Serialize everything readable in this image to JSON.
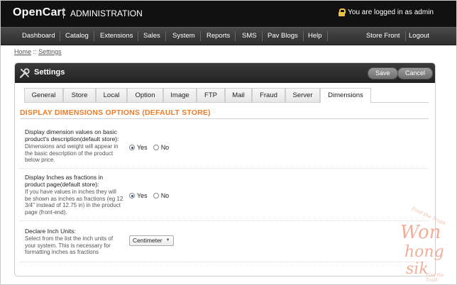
{
  "header": {
    "logo": "OpenCart",
    "title": "ADMINISTRATION",
    "login_status": "You are logged in as admin"
  },
  "nav": {
    "items": [
      "Dashboard",
      "Catalog",
      "Extensions",
      "Sales",
      "System",
      "Reports",
      "SMS",
      "Pav Blogs",
      "Help"
    ],
    "right": [
      "Store Front",
      "Logout"
    ]
  },
  "breadcrumb": {
    "home": "Home",
    "separator": "::",
    "current": "Settings"
  },
  "panel": {
    "title": "Settings",
    "save_label": "Save",
    "cancel_label": "Cancel"
  },
  "tabs": [
    "General",
    "Store",
    "Local",
    "Option",
    "Image",
    "FTP",
    "Mail",
    "Fraud",
    "Server",
    "Dimensions"
  ],
  "active_tab": "Dimensions",
  "section_title": "DISPLAY DIMENSIONS OPTIONS (DEFAULT STORE)",
  "rows": [
    {
      "label": "Display dimension values on basic product's description(default store):",
      "help": "Dimensions and weight will appear in the basic description of the product below price.",
      "yes": "Yes",
      "no": "No",
      "selected": "Yes"
    },
    {
      "label": "Display Inches as fractions in product page(default store):",
      "help": "If you have values in inches they will be shown as inches as fractions (eg 12 3/4\" instead of 12.75 in) in the product page (front-end).",
      "yes": "Yes",
      "no": "No",
      "selected": "Yes"
    },
    {
      "label": "Declare Inch Units:",
      "help": "Select from the list the inch units of your system. This is necessary for formatting inches as fractions",
      "select_value": "Centimeter"
    }
  ],
  "watermark": {
    "line1": "Find the Truth",
    "line2": "Won",
    "line3": "hong",
    "line4": "sik",
    "line5": "Find the Truth"
  },
  "colors": {
    "accent": "#f07b26",
    "header_bg": "#111111",
    "nav_bg": "#3a3a3a",
    "radio_checked": "#2a4f9a"
  }
}
